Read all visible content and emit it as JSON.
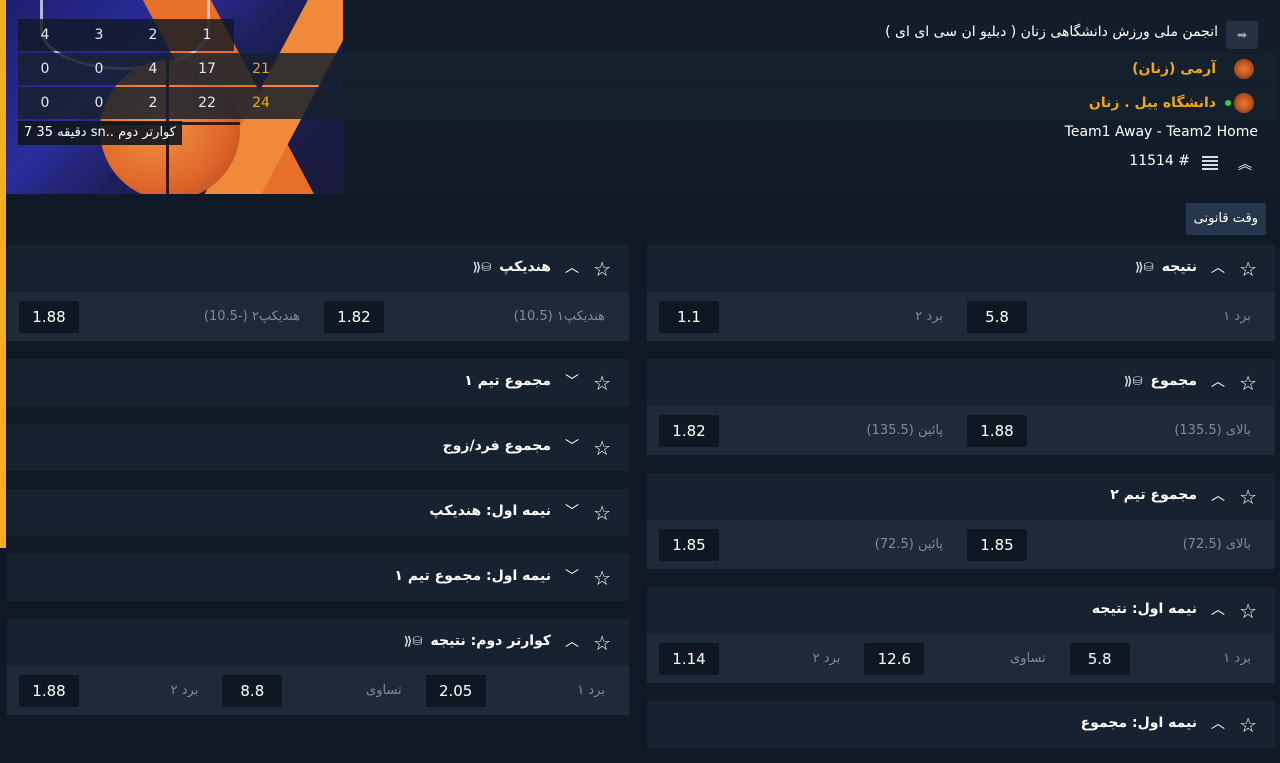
{
  "header": {
    "league_title": "انجمن ملی ورزش دانشگاهی زنان ( دبلیو ان سی ای ای )",
    "period_label": "کوارتر دوم  ..sn دقیقه 35 7",
    "teams_caption": "Team1 Away - Team2 Home",
    "match_id": "11514 #",
    "share_icon": "➡",
    "collapse_icon": "︽",
    "score_rows": [
      {
        "cells": [
          "4",
          "3",
          "2",
          "1"
        ],
        "total": ""
      },
      {
        "cells": [
          "0",
          "0",
          "4",
          "17"
        ],
        "total": "21",
        "team": "آرمی (زنان)",
        "dot": false
      },
      {
        "cells": [
          "0",
          "0",
          "2",
          "22"
        ],
        "total": "24",
        "team": "دانشگاه ییل . زنان",
        "dot": true
      }
    ],
    "colors": {
      "accent": "#f2a51b",
      "live_dot": "#2ed14d"
    }
  },
  "tabs": {
    "regular_time": "وقت قانونی"
  },
  "icons": {
    "star": "☆",
    "chevron_up": "︿",
    "chevron_down": "﹀",
    "coins": "⛁⟪"
  },
  "markets_right": [
    {
      "title": "نتیجه",
      "expanded": true,
      "coins": true,
      "selections": [
        {
          "label": "برد ۱",
          "odd": "5.8"
        },
        {
          "label": "برد ۲",
          "odd": "1.1"
        }
      ]
    },
    {
      "title": "مجموع",
      "expanded": true,
      "coins": true,
      "selections": [
        {
          "label": "بالای (135.5)",
          "odd": "1.88"
        },
        {
          "label": "پائین (135.5)",
          "odd": "1.82"
        }
      ]
    },
    {
      "title": "مجموع تیم ۲",
      "expanded": true,
      "coins": false,
      "selections": [
        {
          "label": "بالای (72.5)",
          "odd": "1.85"
        },
        {
          "label": "پائین (72.5)",
          "odd": "1.85"
        }
      ]
    },
    {
      "title": "نیمه اول: نتیجه",
      "expanded": true,
      "coins": false,
      "selections": [
        {
          "label": "برد ۱",
          "odd": "5.8"
        },
        {
          "label": "تساوی",
          "odd": "12.6"
        },
        {
          "label": "برد ۲",
          "odd": "1.14"
        }
      ]
    },
    {
      "title": "نیمه اول: مجموع",
      "expanded": true,
      "coins": false,
      "selections": []
    }
  ],
  "markets_left": [
    {
      "title": "هندیکپ",
      "expanded": true,
      "coins": true,
      "selections": [
        {
          "label": "هندیکپ۱ (10.5)",
          "odd": "1.82"
        },
        {
          "label": "هندیکپ۲ (-10.5)",
          "odd": "1.88"
        }
      ]
    },
    {
      "title": "مجموع تیم ۱",
      "expanded": false,
      "coins": false,
      "selections": []
    },
    {
      "title": "مجموع فرد/زوج",
      "expanded": false,
      "coins": false,
      "selections": []
    },
    {
      "title": "نیمه اول: هندیکپ",
      "expanded": false,
      "coins": false,
      "selections": []
    },
    {
      "title": "نیمه اول: مجموع تیم ۱",
      "expanded": false,
      "coins": false,
      "selections": []
    },
    {
      "title": "کوارتر دوم: نتیجه",
      "expanded": true,
      "coins": true,
      "selections": [
        {
          "label": "برد ۱",
          "odd": "2.05"
        },
        {
          "label": "تساوی",
          "odd": "8.8"
        },
        {
          "label": "برد ۲",
          "odd": "1.88"
        }
      ]
    }
  ]
}
